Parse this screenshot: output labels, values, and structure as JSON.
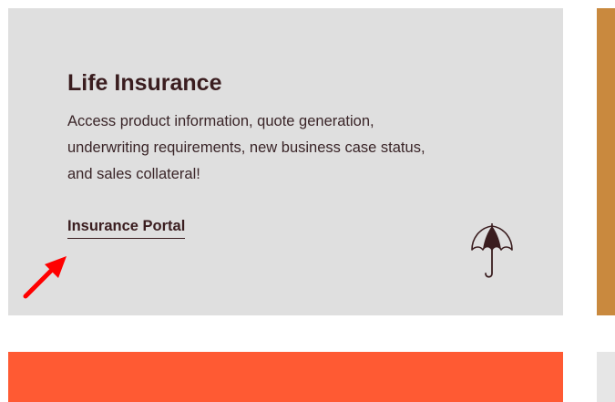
{
  "card": {
    "title": "Life Insurance",
    "description": "Access product information, quote generation, underwriting requirements, new business case status, and sales collateral!",
    "link_label": "Insurance Portal",
    "icon": "umbrella-icon",
    "background": "#dfdfdf",
    "text_color": "#3a1d1f"
  },
  "annotation": {
    "icon": "red-arrow-icon",
    "color": "#ff0000"
  },
  "panels": {
    "right_card_color": "#c9893e",
    "bottom_card_color": "#ff5a33",
    "bottom_right_card_color": "#e6e6e6"
  }
}
